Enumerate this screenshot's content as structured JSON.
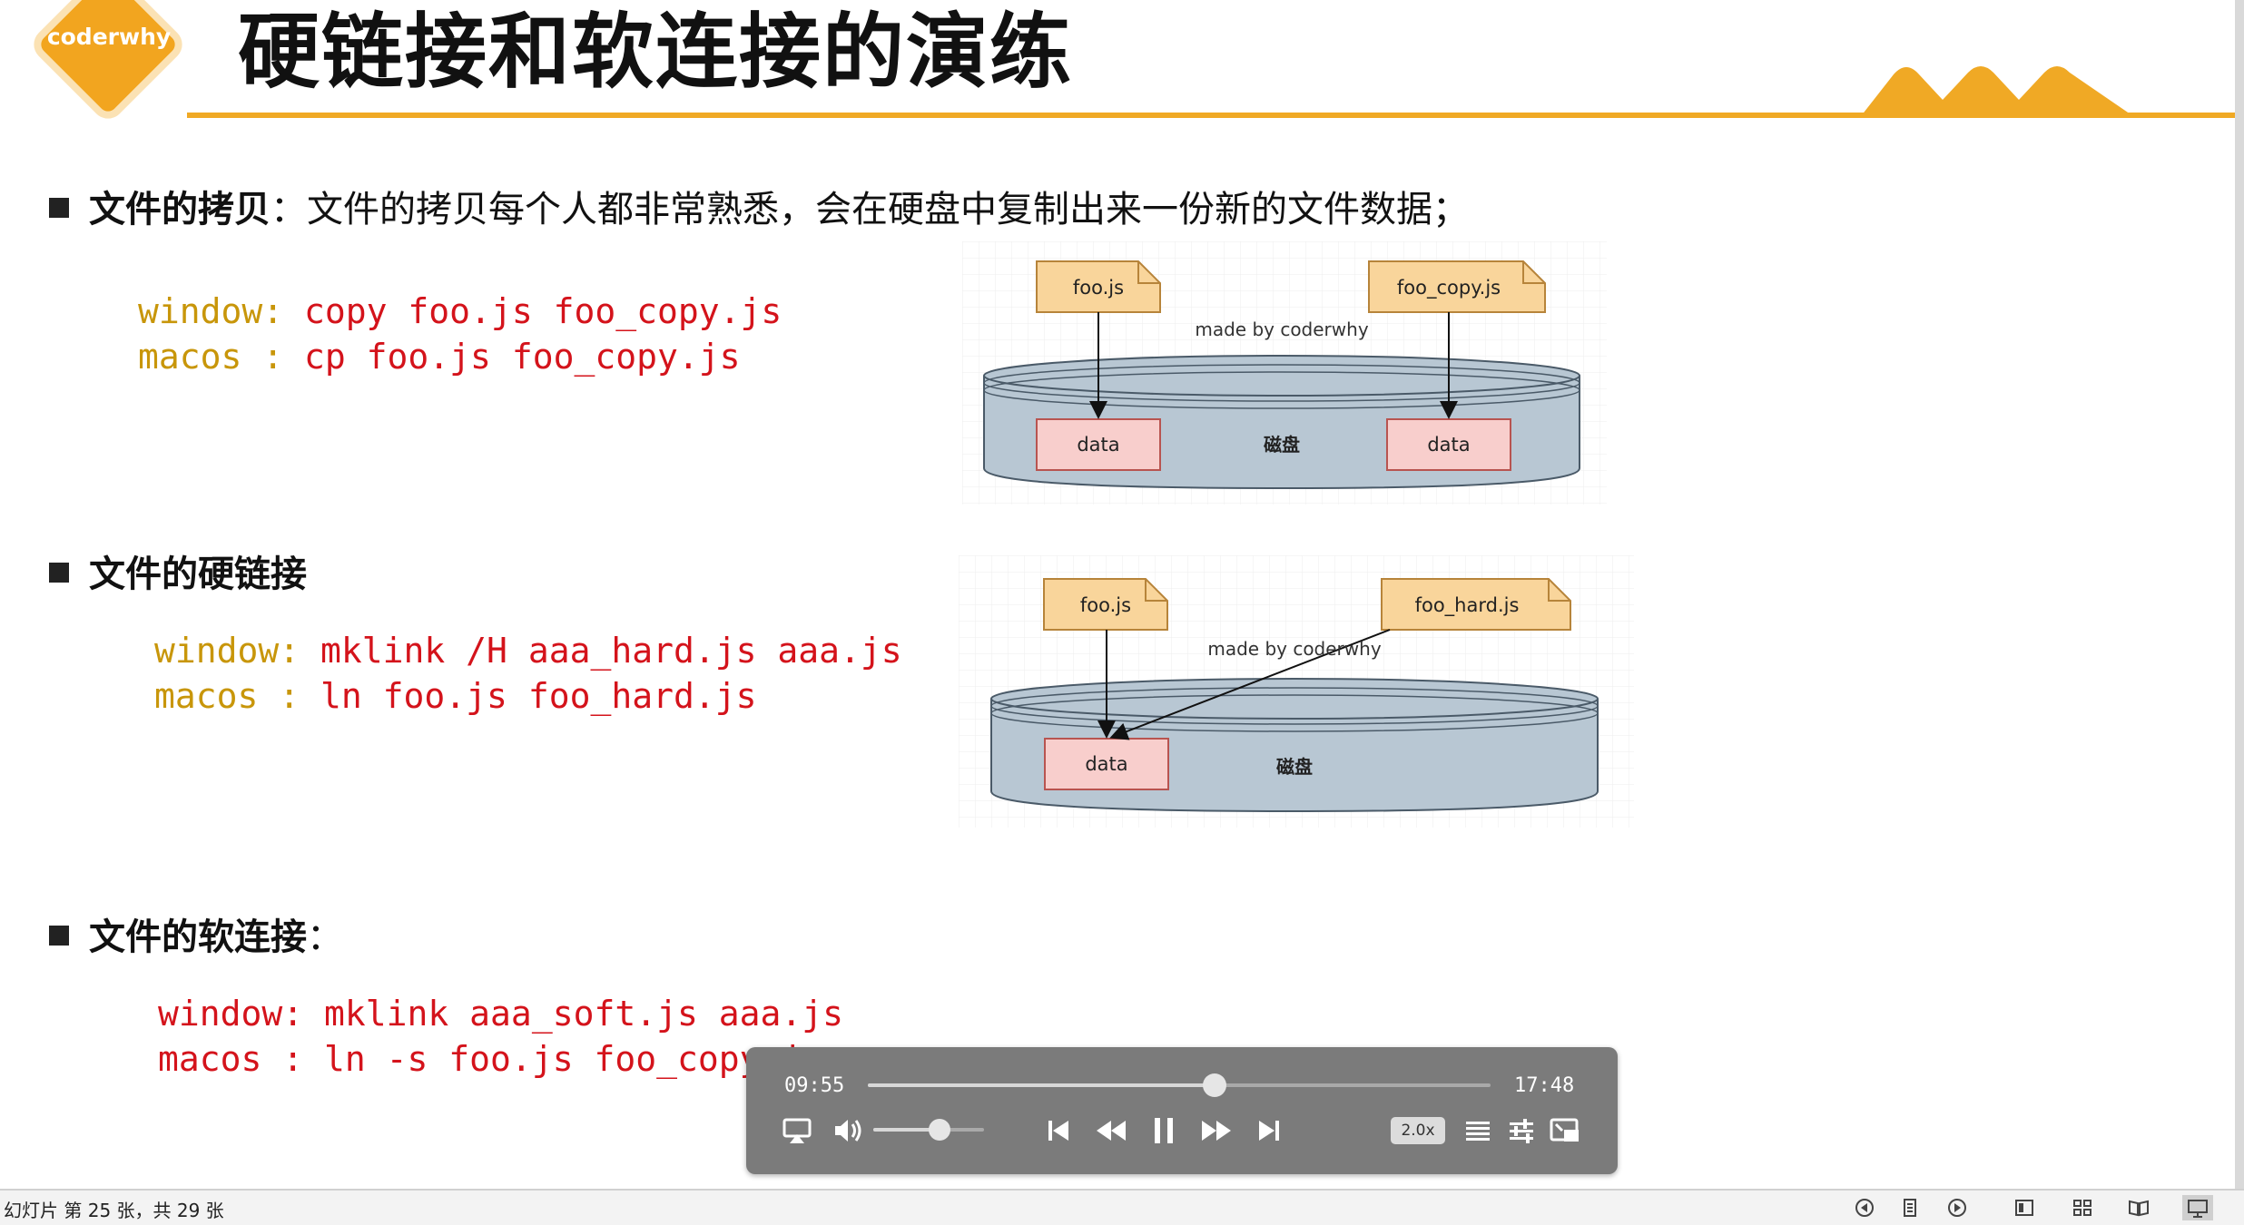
{
  "slide": {
    "logo_text": "coderwhy",
    "title": "硬链接和软连接的演练",
    "sections": [
      {
        "heading": "文件的拷贝",
        "description": "：文件的拷贝每个人都非常熟悉，会在硬盘中复制出来一份新的文件数据；",
        "code": [
          {
            "label": "window:",
            "command": " copy foo.js foo_copy.js"
          },
          {
            "label": "macos :",
            "command": " cp foo.js foo_copy.js"
          }
        ]
      },
      {
        "heading": "文件的硬链接",
        "description": "",
        "code": [
          {
            "label": "window:",
            "command": " mklink /H aaa_hard.js aaa.js"
          },
          {
            "label": "macos :",
            "command": " ln foo.js foo_hard.js"
          }
        ]
      },
      {
        "heading": "文件的软连接",
        "description": "：",
        "code": [
          {
            "label": "window:",
            "command": " mklink aaa_soft.js aaa.js"
          },
          {
            "label": "macos :",
            "command": " ln -s foo.js foo_copy.js"
          }
        ]
      }
    ],
    "diagram_copy": {
      "file_left": "foo.js",
      "file_right": "foo_copy.js",
      "credit": "made by coderwhy",
      "data_left": "data",
      "data_right": "data",
      "disk_label": "磁盘"
    },
    "diagram_hard": {
      "file_left": "foo.js",
      "file_right": "foo_hard.js",
      "credit": "made by coderwhy",
      "data": "data",
      "disk_label": "磁盘"
    }
  },
  "player": {
    "elapsed": "09:55",
    "total": "17:48",
    "progress_fraction": 0.557,
    "volume_fraction": 0.6,
    "speed": "2.0x"
  },
  "statusbar": {
    "slide_info": "幻灯片 第 25 张，共 29 张"
  },
  "colors": {
    "accent": "#f0a925",
    "code_keyword": "#c8960a",
    "code_command": "#d4131b",
    "file_fill": "#f9d59b",
    "data_fill": "#f8cecc",
    "disk_fill": "#b8c7d3"
  }
}
